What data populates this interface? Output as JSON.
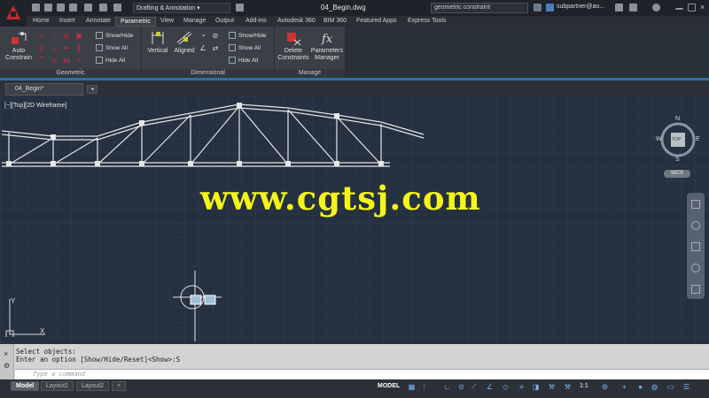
{
  "titlebar": {
    "workspace": "Drafting & Annotation",
    "document": "04_Begin.dwg",
    "search": "geometric constraint",
    "user": "subpartner@au..."
  },
  "menu_tabs": [
    "Home",
    "Insert",
    "Annotate",
    "Parametric",
    "View",
    "Manage",
    "Output",
    "Add-ins",
    "Autodesk 360",
    "BIM 360",
    "Featured Apps",
    "Express Tools"
  ],
  "active_tab": "Parametric",
  "ribbon": {
    "geometric": {
      "title": "Geometric",
      "auto_constrain": "Auto Constrain",
      "show_hide": "Show/Hide",
      "show_all": "Show All",
      "hide_all": "Hide All"
    },
    "dimensional": {
      "title": "Dimensional",
      "vertical": "Vertical",
      "aligned": "Aligned",
      "show_hide": "Show/Hide",
      "show_all": "Show All",
      "hide_all": "Hide All"
    },
    "manage": {
      "title": "Manage",
      "delete": "Delete Constraints",
      "params": "Parameters Manager"
    }
  },
  "file_tab": "04_Begin*",
  "viewport": {
    "label": "[−][Top][2D Wireframe]",
    "watermark": "www.cgtsj.com",
    "wcs": "WCS",
    "compass": {
      "n": "N",
      "s": "S",
      "e": "E",
      "w": "W",
      "top": "TOP"
    }
  },
  "command": {
    "history": [
      "Select objects:",
      "Enter an option [Show/Hide/Reset]<Show>:S"
    ],
    "placeholder": "Type a command"
  },
  "status": {
    "layout_tabs": [
      "Model",
      "Layout1",
      "Layout2"
    ],
    "active_layout": "Model",
    "model": "MODEL",
    "scale": "1:1"
  },
  "colors": {
    "accent": "#2b6fb0",
    "watermark": "#f5f51a"
  }
}
